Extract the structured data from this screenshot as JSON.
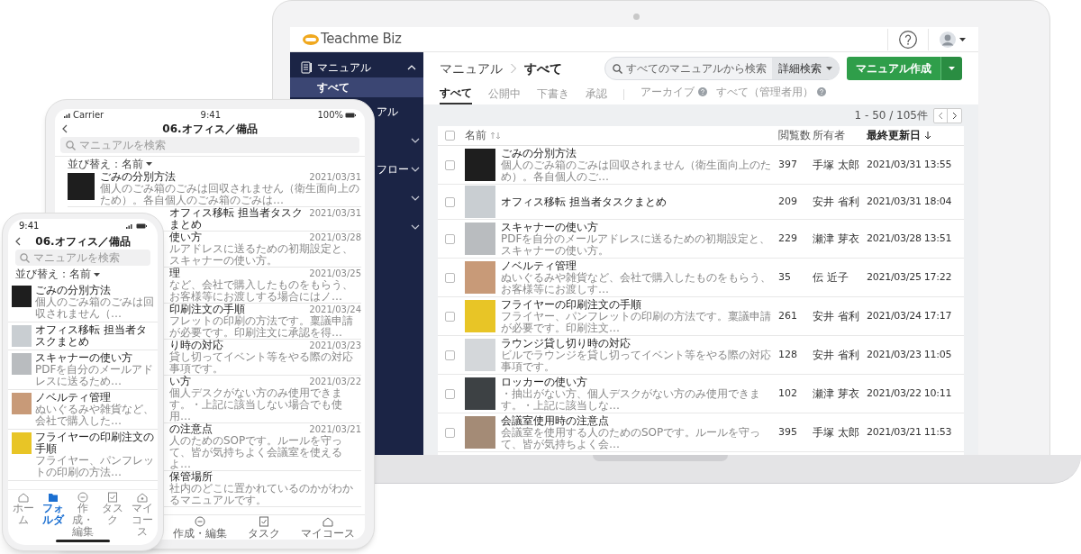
{
  "laptop": {
    "logo": "Teachme Biz",
    "sidebar": {
      "items": [
        {
          "kind": "section",
          "label": "マニュアル",
          "expanded": true
        },
        {
          "kind": "sub",
          "label": "すべて",
          "selected": true
        },
        {
          "kind": "fragment",
          "label": "アル"
        },
        {
          "kind": "blank",
          "expanded": false
        },
        {
          "kind": "fragment",
          "label": "フロー",
          "expanded": false
        },
        {
          "kind": "blank",
          "expanded": false
        },
        {
          "kind": "blank",
          "expanded": false
        }
      ]
    },
    "breadcrumb": [
      "マニュアル",
      "すべて"
    ],
    "search": {
      "placeholder": "すべてのマニュアルから検索",
      "advanced": "詳細検索"
    },
    "create_button": "マニュアル作成",
    "tabs": [
      {
        "label": "すべて",
        "selected": true
      },
      {
        "label": "公開中",
        "selected": false
      },
      {
        "label": "下書き",
        "selected": false
      },
      {
        "label": "承認",
        "selected": false
      }
    ],
    "archive_tabs": [
      {
        "label": "アーカイブ"
      },
      {
        "label": "すべて（管理者用）"
      }
    ],
    "pagination": "1 - 50 / 105件",
    "table": {
      "columns": [
        "名前",
        "閲覧数",
        "所有者",
        "最終更新日"
      ],
      "all_checked": false,
      "rows": [
        {
          "checked": false,
          "title": "ごみの分別方法",
          "description": "個人のごみ箱のごみは回収されません（衛生面向上のため）。各自個人のご…",
          "views": "397",
          "owner": "手塚 太郎",
          "updated": "2021/03/31 13:55"
        },
        {
          "checked": false,
          "title": "オフィス移転 担当者タスクまとめ",
          "views": "209",
          "owner": "安井 省利",
          "updated": "2021/03/31 18:04"
        },
        {
          "checked": false,
          "title": "スキャナーの使い方",
          "description": "PDFを自分のメールアドレスに送るための初期設定と、スキャナーの使い方。",
          "views": "229",
          "owner": "瀬津 芽衣",
          "updated": "2021/03/28 13:51"
        },
        {
          "checked": false,
          "title": "ノベルティ管理",
          "description": "ぬいぐるみや雑貨など、会社で購入したものをもらう、お客様等にお渡しす…",
          "views": "35",
          "owner": "伝 近子",
          "updated": "2021/03/25 17:22"
        },
        {
          "checked": false,
          "title": "フライヤーの印刷注文の手順",
          "description": "フライヤー、パンフレットの印刷の方法です。稟議申請が必要です。印刷注文…",
          "views": "261",
          "owner": "安井 省利",
          "updated": "2021/03/24 17:17"
        },
        {
          "checked": false,
          "title": "ラウンジ貸し切り時の対応",
          "description": "ビルでラウンジを貸し切ってイベント等をやる際の対応事項です。",
          "views": "128",
          "owner": "安井 省利",
          "updated": "2021/03/23 11:05"
        },
        {
          "checked": false,
          "title": "ロッカーの使い方",
          "description": "・抽出がない方、個人デスクがない方のみ使用できます。・上記に該当しな…",
          "views": "102",
          "owner": "瀬津 芽衣",
          "updated": "2021/03/22 10:11"
        },
        {
          "checked": false,
          "title": "会議室使用時の注意点",
          "description": "会議室を使用する人のためのSOPです。ルールを守って、皆が気持ちよく会…",
          "views": "395",
          "owner": "手塚 太郎",
          "updated": "2021/03/21 11:53"
        }
      ]
    }
  },
  "tablet": {
    "status": {
      "carrier": "Carrier",
      "time": "9:41",
      "battery": "100%"
    },
    "title": "06.オフィス／備品",
    "search_placeholder": "マニュアルを検索",
    "sort": "並び替え：名前",
    "rows": [
      {
        "kind": "full",
        "title": "ごみの分別方法",
        "description": "個人のごみ箱のごみは回収されません（衛生面向上のため）。各自個人のごみ箱のごみは…",
        "date": "2021/03/31"
      },
      {
        "kind": "partial",
        "title": "オフィス移転 担当者タスクまとめ",
        "date": "2021/03/31"
      },
      {
        "kind": "partial",
        "title": "使い方",
        "description": "ルアドレスに送るための初期設定と、スキャナーの使い方。",
        "date": "2021/03/28"
      },
      {
        "kind": "partial",
        "title": "理",
        "description": "など、会社で購入したものをもらう、お客様等にお渡しする場合にはノ…",
        "date": "2021/03/25"
      },
      {
        "kind": "partial",
        "title": "印刷注文の手順",
        "description": "フレットの印刷の方法です。稟議申請が必要です。印刷注文に承認を得…",
        "date": "2021/03/24"
      },
      {
        "kind": "partial",
        "title": "り時の対応",
        "description": "貸し切ってイベント等をやる際の対応事項です。",
        "date": "2021/03/23"
      },
      {
        "kind": "partial",
        "title": "い方",
        "description": "個人デスクがない方のみ使用できます。・上記に該当しない場合でも使用…",
        "date": "2021/03/22"
      },
      {
        "kind": "partial",
        "title": "の注意点",
        "description": "人のためのSOPです。ルールを守って、皆が気持ちよく会議室を使えるよ…",
        "date": "2021/03/21"
      },
      {
        "kind": "partial",
        "title": "保管場所",
        "description": "社内のどこに置かれているのかがわかるマニュアルです。"
      }
    ],
    "tabbar": [
      "作成・編集",
      "タスク",
      "マイコース"
    ]
  },
  "phone": {
    "time": "9:41",
    "title": "06.オフィス／備品",
    "search_placeholder": "マニュアルを検索",
    "sort": "並び替え：名前",
    "rows": [
      {
        "title": "ごみの分別方法",
        "description": "個人のごみ箱のごみは回収されません（…"
      },
      {
        "title": "オフィス移転 担当者タスクまとめ"
      },
      {
        "title": "スキャナーの使い方",
        "description": "PDFを自分のメールアドレスに送るため…"
      },
      {
        "title": "ノベルティ管理",
        "description": "ぬいぐるみや雑貨など、会社で購入した…"
      },
      {
        "title": "フライヤーの印刷注文の手順",
        "description": "フライヤー、パンフレットの印刷の方法…"
      }
    ],
    "tabbar": [
      {
        "label": "ホーム",
        "selected": false
      },
      {
        "label": "フォルダ",
        "selected": true
      },
      {
        "label": "作成・編集",
        "selected": false
      },
      {
        "label": "タスク",
        "selected": false
      },
      {
        "label": "マイコース",
        "selected": false
      }
    ]
  }
}
